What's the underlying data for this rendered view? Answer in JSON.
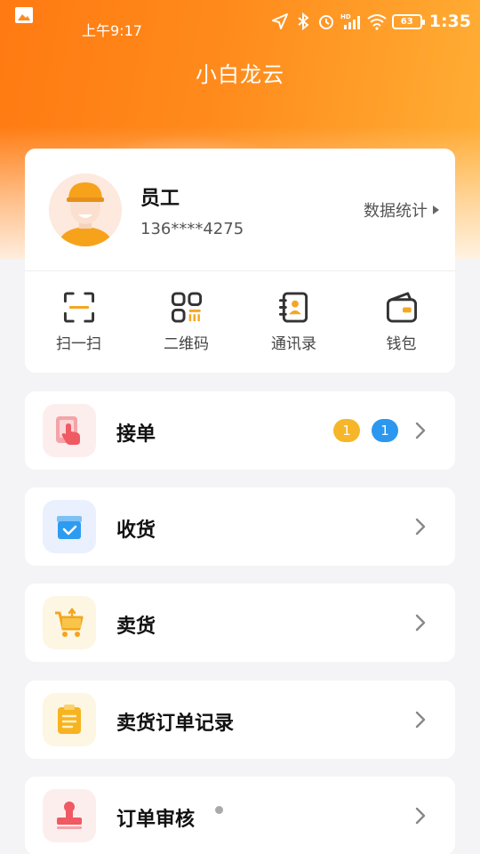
{
  "status_bar": {
    "time": "上午9:17",
    "clock": "1:35",
    "battery": "63",
    "icons": [
      "gallery-icon",
      "location-icon",
      "bluetooth-icon",
      "alarm-icon",
      "hd-signal-icon",
      "wifi-icon",
      "battery-icon"
    ]
  },
  "app": {
    "title": "小白龙云"
  },
  "profile": {
    "name": "员工",
    "phone": "136****4275",
    "stats_link": "数据统计"
  },
  "quick_actions": [
    {
      "label": "扫一扫",
      "icon": "scan-icon"
    },
    {
      "label": "二维码",
      "icon": "qrcode-icon"
    },
    {
      "label": "通讯录",
      "icon": "contacts-icon"
    },
    {
      "label": "钱包",
      "icon": "wallet-icon"
    }
  ],
  "menu": [
    {
      "label": "接单",
      "icon": "tap-order-icon",
      "badges": [
        "1",
        "1"
      ]
    },
    {
      "label": "收货",
      "icon": "receive-box-icon"
    },
    {
      "label": "卖货",
      "icon": "cart-icon"
    },
    {
      "label": "卖货订单记录",
      "icon": "clipboard-icon"
    },
    {
      "label": "订单审核",
      "icon": "stamp-icon"
    }
  ],
  "colors": {
    "brand_orange": "#ff7a12",
    "badge_yellow": "#f6b62a",
    "badge_blue": "#2b97ef"
  }
}
